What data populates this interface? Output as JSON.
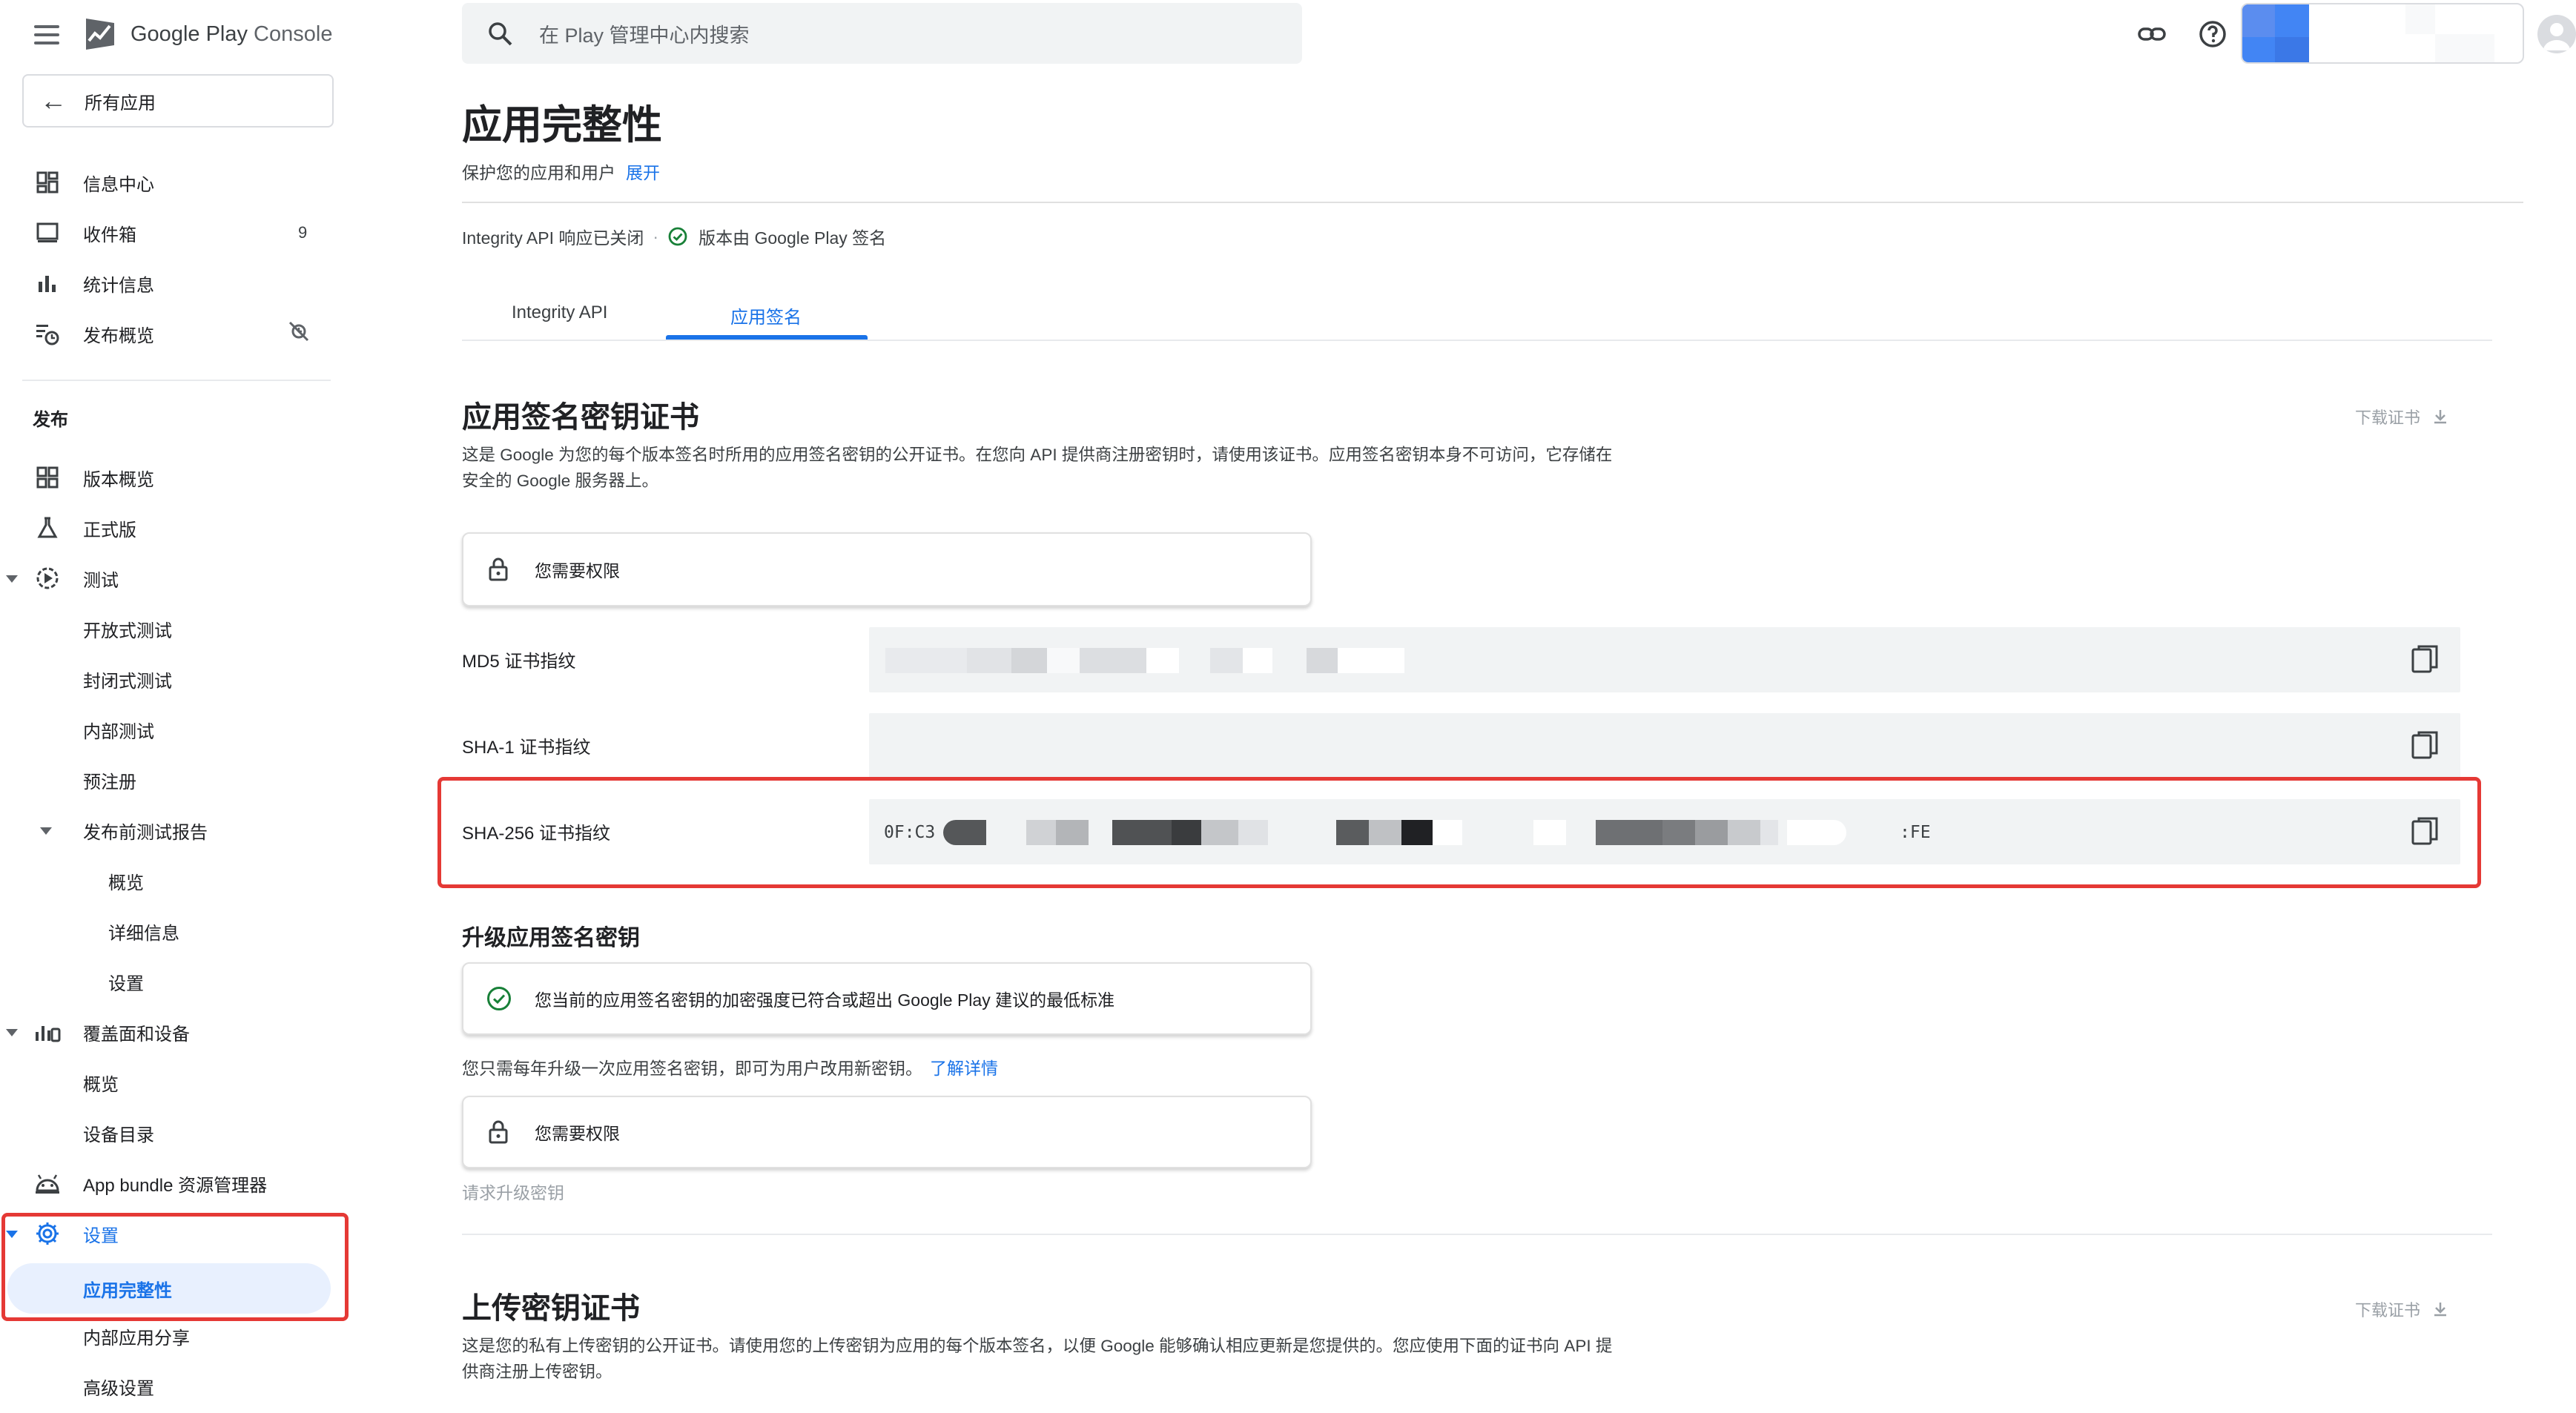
{
  "app": {
    "brand_google": "Google Play",
    "brand_console": " Console"
  },
  "search": {
    "placeholder": "在 Play 管理中心内搜索"
  },
  "sidebar": {
    "back_label": "所有应用",
    "top_items": [
      {
        "label": "信息中心"
      },
      {
        "label": "收件箱",
        "badge": "9"
      },
      {
        "label": "统计信息"
      },
      {
        "label": "发布概览"
      }
    ],
    "section_publish": "发布",
    "release_items": [
      {
        "label": "版本概览"
      },
      {
        "label": "正式版"
      },
      {
        "label": "测试"
      },
      {
        "label": "开放式测试"
      },
      {
        "label": "封闭式测试"
      },
      {
        "label": "内部测试"
      },
      {
        "label": "预注册"
      },
      {
        "label": "发布前测试报告"
      },
      {
        "label": "概览"
      },
      {
        "label": "详细信息"
      },
      {
        "label": "设置"
      },
      {
        "label": "覆盖面和设备"
      },
      {
        "label": "概览"
      },
      {
        "label": "设备目录"
      },
      {
        "label": "App bundle 资源管理器"
      },
      {
        "label": "设置"
      },
      {
        "label": "应用完整性"
      },
      {
        "label": "内部应用分享"
      },
      {
        "label": "高级设置"
      }
    ]
  },
  "page": {
    "title": "应用完整性",
    "subtitle": "保护您的应用和用户",
    "subtitle_link": "展开",
    "status_api": "Integrity API 响应已关闭",
    "status_dot": "·",
    "status_signed": "版本由 Google Play 签名",
    "tabs": [
      {
        "label": "Integrity API"
      },
      {
        "label": "应用签名"
      }
    ]
  },
  "signing_cert": {
    "title": "应用签名密钥证书",
    "download_label": "下载证书",
    "description": "这是 Google 为您的每个版本签名时所用的应用签名密钥的公开证书。在您向 API 提供商注册密钥时，请使用该证书。应用签名密钥本身不可访问，它存储在安全的 Google 服务器上。",
    "permission_card": "您需要权限",
    "md5_label": "MD5 证书指纹",
    "sha1_label": "SHA-1 证书指纹",
    "sha256_label": "SHA-256 证书指纹",
    "sha256_prefix": "0F:C3",
    "sha256_suffix": ":FE"
  },
  "upgrade": {
    "title": "升级应用签名密钥",
    "ok_card": "您当前的应用签名密钥的加密强度已符合或超出 Google Play 建议的最低标准",
    "note": "您只需每年升级一次应用签名密钥，即可为用户改用新密钥。",
    "note_link": "了解详情",
    "permission_card": "您需要权限",
    "request_label": "请求升级密钥"
  },
  "upload_cert": {
    "title": "上传密钥证书",
    "download_label": "下载证书",
    "description": "这是您的私有上传密钥的公开证书。请使用您的上传密钥为应用的每个版本签名，以便 Google 能够确认相应更新是您提供的。您应使用下面的证书向 API 提供商注册上传密钥。"
  },
  "colors": {
    "accent": "#1a73e8",
    "highlight_red": "#e53935",
    "success_green": "#188038"
  }
}
